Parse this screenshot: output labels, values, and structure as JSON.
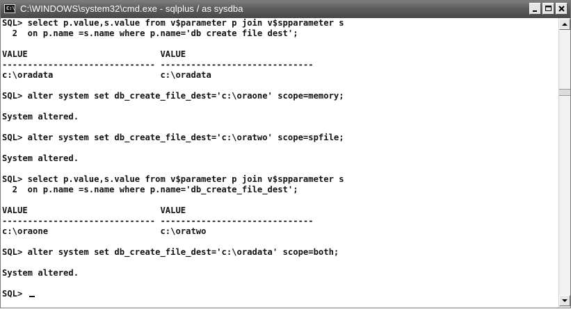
{
  "window": {
    "title": "C:\\WINDOWS\\system32\\cmd.exe - sqlplus / as sysdba",
    "icon_text": "C:\\"
  },
  "controls": {
    "minimize": "minimize-icon",
    "maximize": "maximize-icon",
    "close": "close-icon"
  },
  "console": {
    "lines": [
      "SQL> select p.value,s.value from v$parameter p join v$spparameter s",
      "  2  on p.name =s.name where p.name='db create file dest';",
      "",
      "VALUE                          VALUE",
      "------------------------------ ------------------------------",
      "c:\\oradata                     c:\\oradata",
      "",
      "SQL> alter system set db_create_file_dest='c:\\oraone' scope=memory;",
      "",
      "System altered.",
      "",
      "SQL> alter system set db_create_file_dest='c:\\oratwo' scope=spfile;",
      "",
      "System altered.",
      "",
      "SQL> select p.value,s.value from v$parameter p join v$spparameter s",
      "  2  on p.name =s.name where p.name='db_create_file_dest';",
      "",
      "VALUE                          VALUE",
      "------------------------------ ------------------------------",
      "c:\\oraone                      c:\\oratwo",
      "",
      "SQL> alter system set db_create_file_dest='c:\\oradata' scope=both;",
      "",
      "System altered.",
      "",
      "SQL> "
    ]
  }
}
